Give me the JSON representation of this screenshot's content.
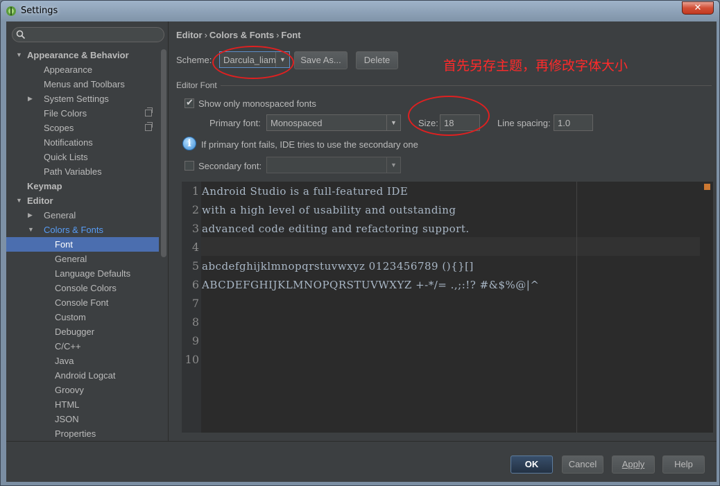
{
  "window": {
    "title": "Settings",
    "close_label": "✕"
  },
  "sidebar": {
    "search": {
      "placeholder": ""
    },
    "items": [
      {
        "label": "Appearance & Behavior",
        "level": 0,
        "expanded": true,
        "bold": true
      },
      {
        "label": "Appearance",
        "level": 1
      },
      {
        "label": "Menus and Toolbars",
        "level": 1
      },
      {
        "label": "System Settings",
        "level": 1,
        "collapsed": true
      },
      {
        "label": "File Colors",
        "level": 1,
        "copy_icon": true
      },
      {
        "label": "Scopes",
        "level": 1,
        "copy_icon": true
      },
      {
        "label": "Notifications",
        "level": 1
      },
      {
        "label": "Quick Lists",
        "level": 1
      },
      {
        "label": "Path Variables",
        "level": 1
      },
      {
        "label": "Keymap",
        "level": 0,
        "bold": true
      },
      {
        "label": "Editor",
        "level": 0,
        "expanded": true,
        "bold": true
      },
      {
        "label": "General",
        "level": 1,
        "collapsed": true
      },
      {
        "label": "Colors & Fonts",
        "level": 1,
        "expanded": true,
        "link": true
      },
      {
        "label": "Font",
        "level": 2,
        "selected": true
      },
      {
        "label": "General",
        "level": 2
      },
      {
        "label": "Language Defaults",
        "level": 2
      },
      {
        "label": "Console Colors",
        "level": 2
      },
      {
        "label": "Console Font",
        "level": 2
      },
      {
        "label": "Custom",
        "level": 2
      },
      {
        "label": "Debugger",
        "level": 2
      },
      {
        "label": "C/C++",
        "level": 2
      },
      {
        "label": "Java",
        "level": 2
      },
      {
        "label": "Android Logcat",
        "level": 2
      },
      {
        "label": "Groovy",
        "level": 2
      },
      {
        "label": "HTML",
        "level": 2
      },
      {
        "label": "JSON",
        "level": 2
      },
      {
        "label": "Properties",
        "level": 2
      }
    ]
  },
  "breadcrumb": {
    "part1": "Editor",
    "part2": "Colors & Fonts",
    "part3": "Font",
    "sep": "›"
  },
  "scheme": {
    "label": "Scheme:",
    "value": "Darcula_liam",
    "save_as": "Save As...",
    "delete": "Delete"
  },
  "annotation": "首先另存主题，再修改字体大小",
  "editor_font": {
    "section_label": "Editor Font",
    "mono_only_label": "Show only monospaced fonts",
    "mono_only_checked": true,
    "primary_label": "Primary font:",
    "primary_value": "Monospaced",
    "size_label": "Size:",
    "size_value": "18",
    "spacing_label": "Line spacing:",
    "spacing_value": "1.0",
    "info_text": "If primary font fails, IDE tries to use the secondary one",
    "secondary_label": "Secondary font:",
    "secondary_checked": false,
    "secondary_value": ""
  },
  "preview": {
    "line_numbers": [
      "1",
      "2",
      "3",
      "4",
      "5",
      "6",
      "7",
      "8",
      "9",
      "10"
    ],
    "lines": [
      "Android Studio is a full-featured IDE",
      "with a high level of usability and outstanding",
      "advanced code editing and refactoring support.",
      "",
      "abcdefghijklmnopqrstuvwxyz 0123456789 (){}[]",
      "ABCDEFGHIJKLMNOPQRSTUVWXYZ +-*/= .,;:!? #&$%@|^"
    ]
  },
  "footer": {
    "ok": "OK",
    "cancel": "Cancel",
    "apply": "Apply",
    "help": "Help"
  },
  "colors": {
    "accent": "#4b6eaf",
    "annotation": "#ff2a2a",
    "background": "#3c3f41",
    "editor_bg": "#2b2b2b"
  }
}
